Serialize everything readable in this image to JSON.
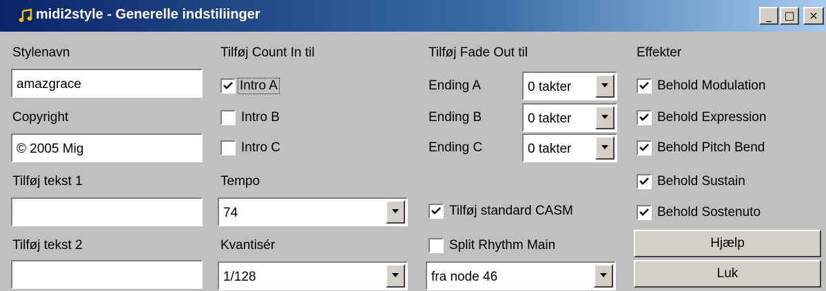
{
  "window": {
    "title": "midi2style - Generelle indstiliinger",
    "icon": "music-note-icon",
    "controls": {
      "minimize": "_",
      "maximize": "□",
      "close": "×"
    }
  },
  "col1": {
    "stylename_label": "Stylenavn",
    "stylename_value": "amazgrace",
    "copyright_label": "Copyright",
    "copyright_value": "© 2005 Mig",
    "text1_label": "Tilføj tekst 1",
    "text1_value": "",
    "text2_label": "Tilføj tekst 2",
    "text2_value": ""
  },
  "col2": {
    "countin_label": "Tilføj Count In til",
    "intro_a": {
      "label": "Intro A",
      "checked": true
    },
    "intro_b": {
      "label": "Intro B",
      "checked": false
    },
    "intro_c": {
      "label": "Intro C",
      "checked": false
    },
    "tempo_label": "Tempo",
    "tempo_value": "74",
    "quantize_label": "Kvantisér",
    "quantize_value": "1/128"
  },
  "col3": {
    "fadeout_label": "Tilføj Fade Out til",
    "ending_a": {
      "label": "Ending A",
      "value": "0 takter"
    },
    "ending_b": {
      "label": "Ending B",
      "value": "0 takter"
    },
    "ending_c": {
      "label": "Ending C",
      "value": "0 takter"
    },
    "casm": {
      "label": "Tilføj standard CASM",
      "checked": true
    },
    "split": {
      "label": "Split Rhythm Main",
      "checked": false
    },
    "node_value": "fra node 46"
  },
  "col4": {
    "effects_label": "Effekter",
    "modulation": {
      "label": "Behold Modulation",
      "checked": true
    },
    "expression": {
      "label": "Behold Expression",
      "checked": true
    },
    "pitchbend": {
      "label": "Behold Pitch Bend",
      "checked": true
    },
    "sustain": {
      "label": "Behold Sustain",
      "checked": true
    },
    "sostenuto": {
      "label": "Behold Sostenuto",
      "checked": true
    },
    "help_button": "Hjælp",
    "close_button": "Luk"
  }
}
